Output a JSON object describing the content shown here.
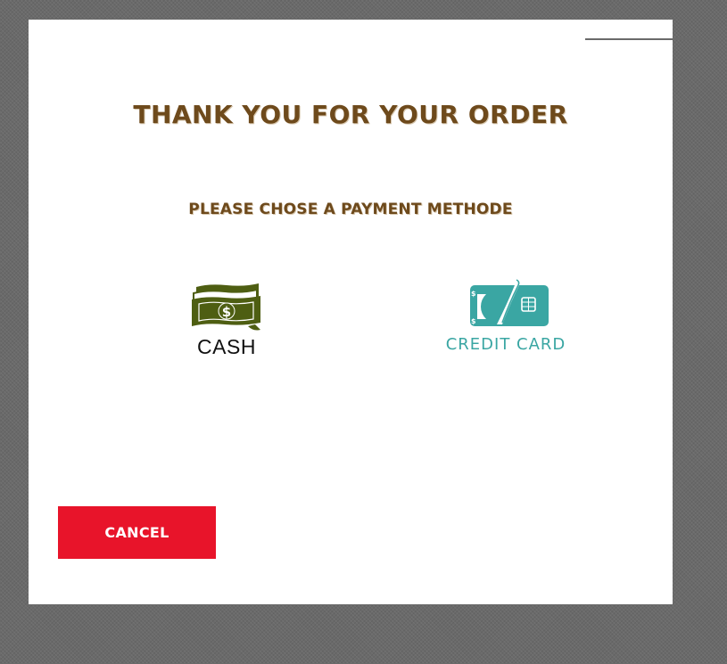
{
  "modal": {
    "title": "THANK YOU FOR YOUR ORDER",
    "subtitle": "PLEASE CHOSE A PAYMENT METHODE"
  },
  "payment_options": [
    {
      "label": "CASH",
      "icon": "cash-icon",
      "color": "#4e5e12"
    },
    {
      "label": "CREDIT CARD",
      "icon": "credit-card-icon",
      "color": "#3aa6a3"
    }
  ],
  "actions": {
    "cancel_label": "CANCEL"
  },
  "colors": {
    "title": "#6e4a1c",
    "cancel_bg": "#e8142a",
    "card_accent": "#3aa6a3",
    "cash_accent": "#4e5e12",
    "backdrop": "#6a6a6a"
  }
}
